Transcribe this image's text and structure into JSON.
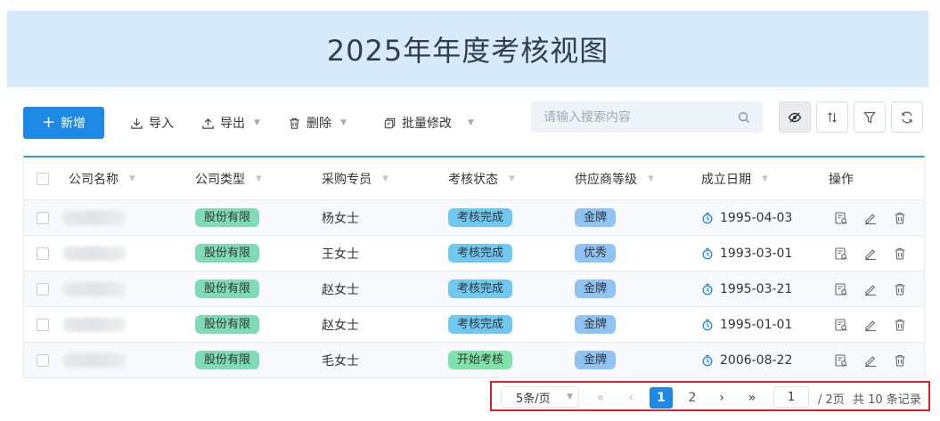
{
  "header": {
    "title": "2025年年度考核视图"
  },
  "toolbar": {
    "add_label": "新增",
    "import_label": "导入",
    "export_label": "导出",
    "delete_label": "删除",
    "batch_edit_label": "批量修改",
    "search_placeholder": "请输入搜索内容",
    "icons": [
      "eye-off-icon",
      "sort-icon",
      "filter-icon",
      "refresh-icon"
    ]
  },
  "table": {
    "columns": [
      "公司名称",
      "公司类型",
      "采购专员",
      "考核状态",
      "供应商等级",
      "成立日期",
      "操作"
    ],
    "rows": [
      {
        "company": "",
        "type": "股份有限",
        "buyer": "杨女士",
        "status": "考核完成",
        "level": "金牌",
        "date": "1995-04-03"
      },
      {
        "company": "",
        "type": "股份有限",
        "buyer": "王女士",
        "status": "考核完成",
        "level": "优秀",
        "date": "1993-03-01"
      },
      {
        "company": "",
        "type": "股份有限",
        "buyer": "赵女士",
        "status": "考核完成",
        "level": "金牌",
        "date": "1995-03-21"
      },
      {
        "company": "",
        "type": "股份有限",
        "buyer": "赵女士",
        "status": "考核完成",
        "level": "金牌",
        "date": "1995-01-01"
      },
      {
        "company": "",
        "type": "股份有限",
        "buyer": "毛女士",
        "status": "开始考核",
        "level": "金牌",
        "date": "2006-08-22"
      }
    ]
  },
  "pagination": {
    "page_size": "5条/页",
    "pages": [
      "1",
      "2"
    ],
    "current_page": "1",
    "total_pages": "/ 2页",
    "total_records": "共 10 条记录"
  },
  "colors": {
    "primary": "#1e88e5",
    "header_bg": "#d6eafb",
    "highlight_border": "#e0212a"
  }
}
